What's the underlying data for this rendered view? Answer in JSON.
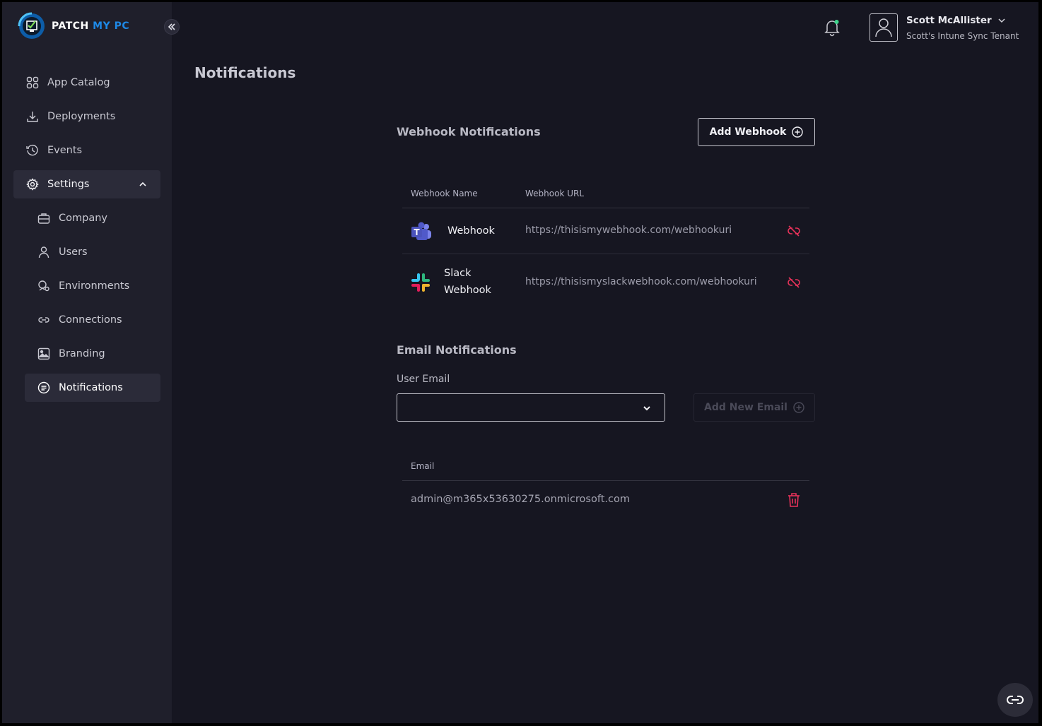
{
  "brand": {
    "name_part1": "PATCH",
    "name_part2": "MY PC",
    "accent_color": "#1e88e5"
  },
  "sidebar": {
    "items": [
      {
        "label": "App Catalog",
        "icon": "grid-icon"
      },
      {
        "label": "Deployments",
        "icon": "download-icon"
      },
      {
        "label": "Events",
        "icon": "history-icon"
      },
      {
        "label": "Settings",
        "icon": "gear-icon",
        "expanded": true
      }
    ],
    "sub_items": [
      {
        "label": "Company",
        "icon": "briefcase-icon"
      },
      {
        "label": "Users",
        "icon": "user-icon"
      },
      {
        "label": "Environments",
        "icon": "environment-icon"
      },
      {
        "label": "Connections",
        "icon": "link-icon"
      },
      {
        "label": "Branding",
        "icon": "image-icon"
      },
      {
        "label": "Notifications",
        "icon": "notification-icon",
        "active": true
      }
    ]
  },
  "header": {
    "user_name": "Scott McAllister",
    "tenant": "Scott's Intune Sync Tenant"
  },
  "page": {
    "title": "Notifications"
  },
  "webhooks": {
    "section_title": "Webhook Notifications",
    "add_button": "Add Webhook",
    "col_name": "Webhook Name",
    "col_url": "Webhook URL",
    "rows": [
      {
        "name": "Webhook",
        "url": "https://thisismywebhook.com/webhookuri",
        "type": "teams-icon"
      },
      {
        "name_line1": "Slack",
        "name_line2": "Webhook",
        "url": "https://thisismyslackwebhook.com/webhookuri",
        "type": "slack-icon"
      }
    ]
  },
  "email": {
    "section_title": "Email Notifications",
    "field_label": "User Email",
    "selected": "",
    "add_button": "Add New Email",
    "col_email": "Email",
    "rows": [
      {
        "email": "admin@m365x53630275.onmicrosoft.com"
      }
    ]
  },
  "colors": {
    "danger": "#e8325a",
    "sidebar_bg": "#1f1f2b",
    "page_bg": "#161621"
  }
}
